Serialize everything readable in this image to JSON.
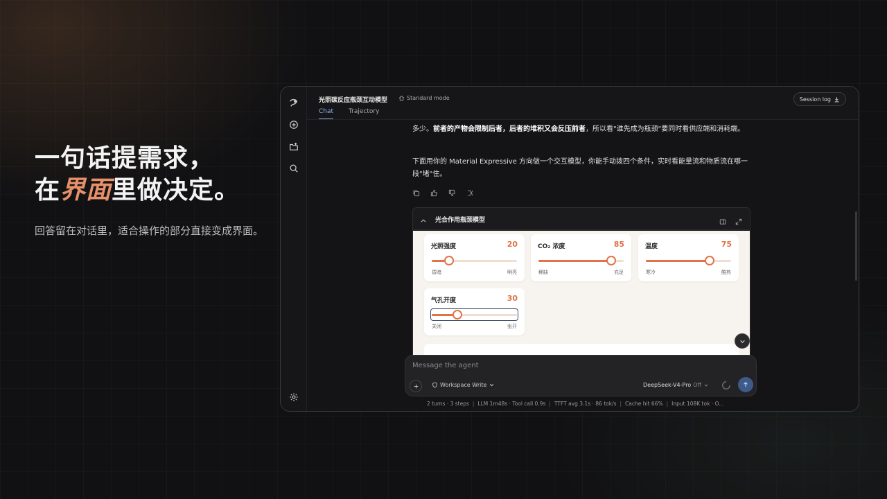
{
  "hero": {
    "line1": "一句话提需求，",
    "line2_prefix": "在",
    "line2_accent": "界面",
    "line2_suffix": "里做决定。",
    "subtitle": "回答留在对话里，适合操作的部分直接变成界面。"
  },
  "window": {
    "title": "光照碳反应瓶颈互动模型",
    "mode": "Standard mode",
    "tabs": [
      {
        "label": "Chat",
        "active": true
      },
      {
        "label": "Trajectory",
        "active": false
      }
    ],
    "session_log": "Session log"
  },
  "chat": {
    "para1_start": "多少。",
    "para1_bold1": "前者的产物会限制后者，后者的堆积又会反压前者",
    "para1_end": "，所以看\"谁先成为瓶颈\"要同时看供应端和消耗端。",
    "para2": "下面用你的 Material Expressive 方向做一个交互模型，你能手动拨四个条件，实时看能量流和物质流在哪一段\"堵\"住。"
  },
  "panel": {
    "title": "光合作用瓶颈模型",
    "sliders": [
      {
        "label": "光照强度",
        "value": "20",
        "fraction": 0.2,
        "min_label": "昏暗",
        "max_label": "明亮"
      },
      {
        "label": "CO₂ 浓度",
        "value": "85",
        "fraction": 0.85,
        "min_label": "稀缺",
        "max_label": "充足"
      },
      {
        "label": "温度",
        "value": "75",
        "fraction": 0.75,
        "min_label": "寒冷",
        "max_label": "酷热"
      },
      {
        "label": "气孔开度",
        "value": "30",
        "fraction": 0.3,
        "min_label": "关闭",
        "max_label": "张开"
      }
    ]
  },
  "composer": {
    "placeholder": "Message the agent",
    "workspace": "Workspace Write",
    "model": "DeepSeek-V4-Pro",
    "model_state": "Off"
  },
  "status": {
    "turns": "2 turns · 3 steps",
    "llm": "LLM 1m48s · Tool call 0.9s",
    "ttft": "TTFT avg 3.1s · 86 tok/s",
    "cache": "Cache hit 66%",
    "input": "Input 108K tok · O..."
  },
  "colors": {
    "accent": "#e07448",
    "link": "#8ab4f8",
    "send": "#3e5a8a"
  }
}
